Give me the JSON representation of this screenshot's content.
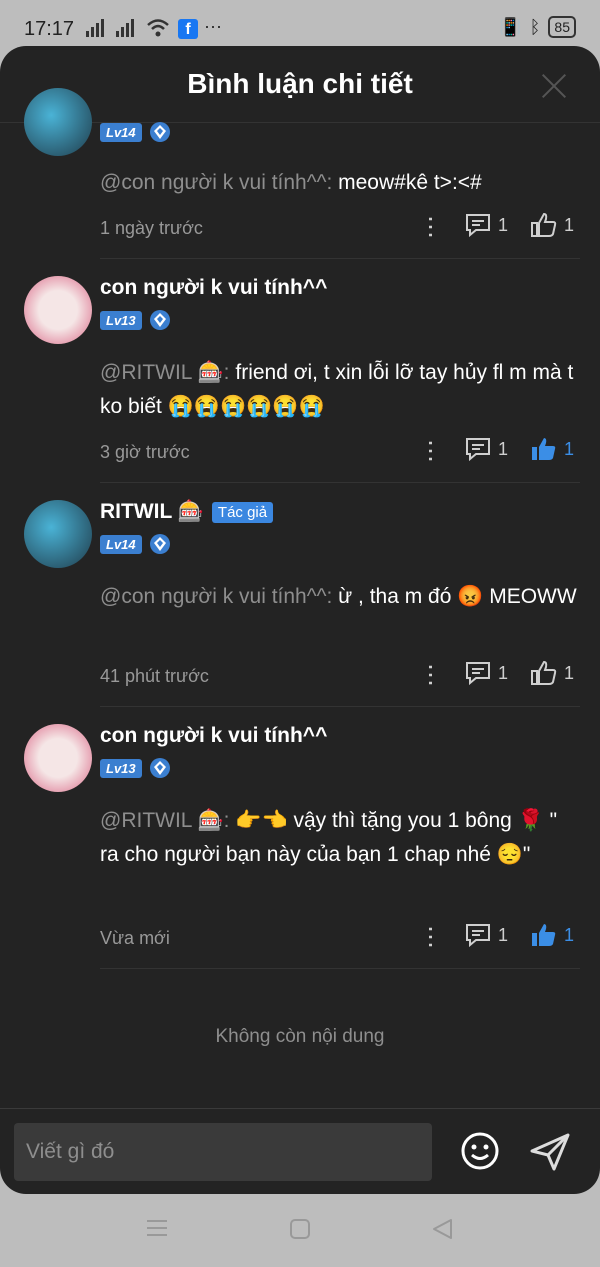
{
  "status_bar": {
    "time": "17:17",
    "battery": "85"
  },
  "header": {
    "title": "Bình luận chi tiết"
  },
  "comments": [
    {
      "username": "",
      "level": "Lv14",
      "author_badge": "",
      "mention": "@con người k vui tính^^:",
      "text": " meow#kê t>:<#",
      "time": "1 ngày trước",
      "reply_count": "1",
      "like_count": "1",
      "liked": false
    },
    {
      "username": "con người k vui tính^^",
      "level": "Lv13",
      "author_badge": "",
      "mention": "@RITWIL 🎰:",
      "text": " friend ơi, t xin lỗi lỡ tay hủy fl m mà t ko biết 😭😭😭😭😭😭",
      "time": "3 giờ trước",
      "reply_count": "1",
      "like_count": "1",
      "liked": true
    },
    {
      "username": "RITWIL 🎰",
      "level": "Lv14",
      "author_badge": "Tác giả",
      "mention": "@con người k vui tính^^:",
      "text": " ừ , tha m đó 😡 MEOWW",
      "time": "41 phút trước",
      "reply_count": "1",
      "like_count": "1",
      "liked": false
    },
    {
      "username": "con người k vui tính^^",
      "level": "Lv13",
      "author_badge": "",
      "mention": "@RITWIL 🎰:",
      "text": " 👉👈 vậy thì tặng you 1 bông 🌹 \" ra cho người bạn này của bạn 1 chap nhé 😔\"",
      "time": "Vừa mới",
      "reply_count": "1",
      "like_count": "1",
      "liked": true
    }
  ],
  "empty_message": "Không còn nội dung",
  "composer": {
    "placeholder": "Viết gì đó"
  },
  "colors": {
    "accent": "#3b8ee6",
    "sheet_bg": "#232323",
    "muted": "#8e8e8e"
  }
}
